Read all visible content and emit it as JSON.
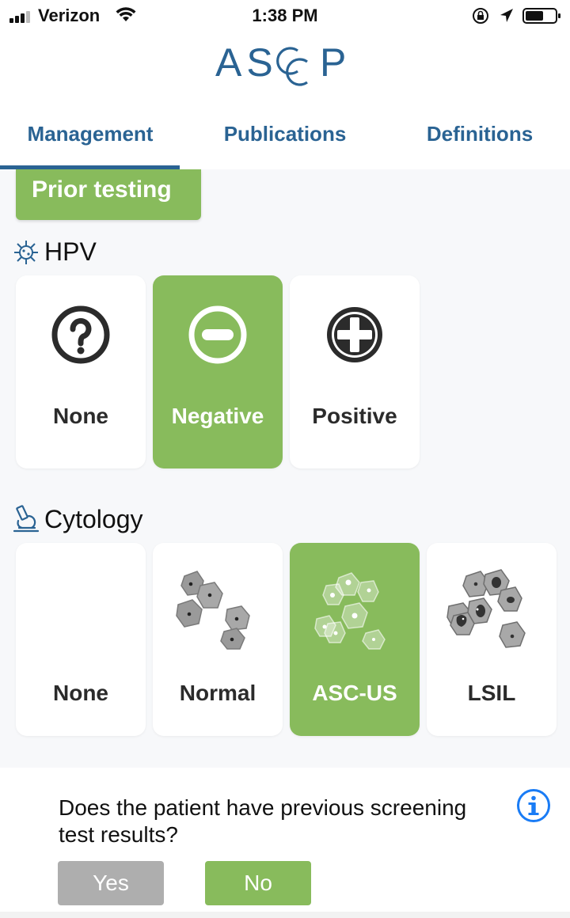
{
  "status_bar": {
    "carrier": "Verizon",
    "time": "1:38 PM",
    "icons": [
      "signal-icon",
      "wifi-icon",
      "orientation-lock-icon",
      "location-arrow-icon",
      "battery-icon"
    ]
  },
  "logo": {
    "text": "ASCCP"
  },
  "tabs": [
    {
      "label": "Management",
      "active": true
    },
    {
      "label": "Publications",
      "active": false
    },
    {
      "label": "Definitions",
      "active": false
    }
  ],
  "banner": {
    "label": "Prior testing"
  },
  "hpv": {
    "title": "HPV",
    "icon": "virus-icon",
    "options": [
      {
        "label": "None",
        "icon": "question-circle-icon",
        "selected": false
      },
      {
        "label": "Negative",
        "icon": "minus-circle-icon",
        "selected": true
      },
      {
        "label": "Positive",
        "icon": "plus-circle-icon",
        "selected": false
      }
    ]
  },
  "cytology": {
    "title": "Cytology",
    "icon": "microscope-icon",
    "options": [
      {
        "label": "None",
        "icon": "",
        "selected": false
      },
      {
        "label": "Normal",
        "icon": "normal-cells-icon",
        "selected": false
      },
      {
        "label": "ASC-US",
        "icon": "ascus-cells-icon",
        "selected": true
      },
      {
        "label": "LSIL",
        "icon": "lsil-cells-icon",
        "selected": false
      }
    ]
  },
  "question": {
    "text": "Does the patient have previous screening test results?",
    "info_icon": "info-circle-icon",
    "yes_label": "Yes",
    "no_label": "No"
  },
  "colors": {
    "accent_green": "#88bb5c",
    "brand_blue": "#2a6393",
    "disabled_gray": "#aeaeae",
    "info_blue": "#1a7cf5"
  }
}
